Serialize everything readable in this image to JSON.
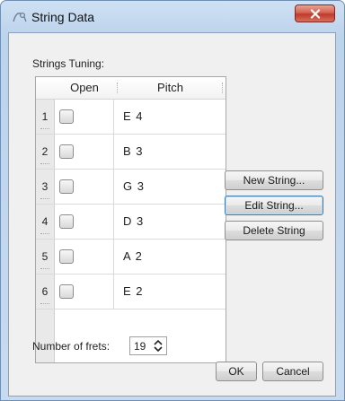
{
  "window": {
    "title": "String Data"
  },
  "tuning": {
    "label": "Strings Tuning:",
    "columns": {
      "open": "Open",
      "pitch": "Pitch"
    },
    "rows": [
      {
        "num": "1",
        "pitch": "E 4",
        "open": false
      },
      {
        "num": "2",
        "pitch": "B 3",
        "open": false
      },
      {
        "num": "3",
        "pitch": "G 3",
        "open": false
      },
      {
        "num": "4",
        "pitch": "D 3",
        "open": false
      },
      {
        "num": "5",
        "pitch": "A 2",
        "open": false
      },
      {
        "num": "6",
        "pitch": "E 2",
        "open": false
      }
    ]
  },
  "actions": {
    "new_string": "New String...",
    "edit_string": "Edit String...",
    "delete_string": "Delete String"
  },
  "frets": {
    "label": "Number of frets:",
    "value": "19"
  },
  "footer": {
    "ok": "OK",
    "cancel": "Cancel"
  },
  "colors": {
    "titlebar": "#c7dbf0",
    "close": "#c0392b",
    "client": "#f0f0f0"
  }
}
